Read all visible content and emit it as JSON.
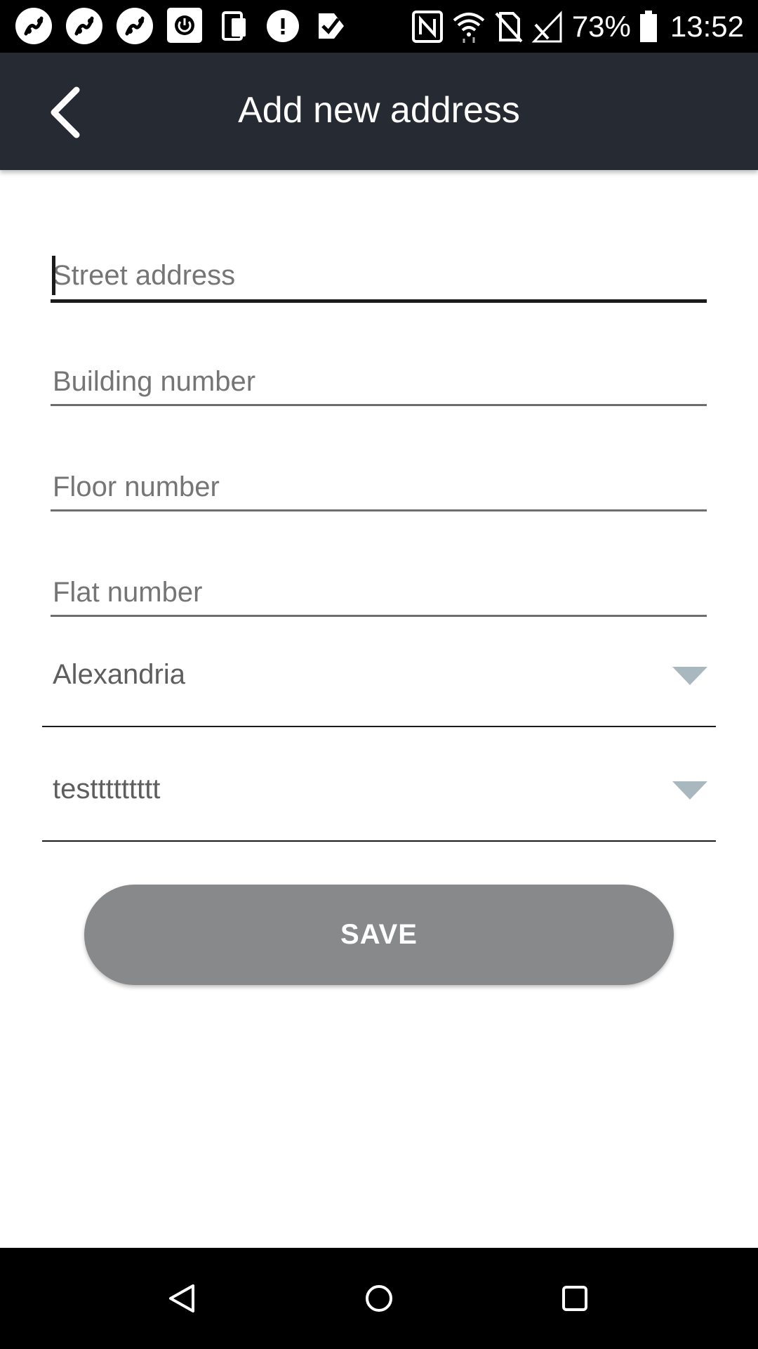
{
  "status_bar": {
    "battery_percent": "73%",
    "time": "13:52",
    "left_icons": [
      "app-notification-icon",
      "app-notification-icon",
      "app-notification-icon",
      "power-icon",
      "device-icon",
      "alert-icon",
      "check-icon"
    ],
    "right_icons": [
      "nfc-icon",
      "wifi-icon",
      "no-sim-icon",
      "signal-icon",
      "battery-icon"
    ]
  },
  "app_bar": {
    "title": "Add new address",
    "background": "#262a32"
  },
  "form": {
    "street_address": {
      "value": "",
      "placeholder": "Street address"
    },
    "building_number": {
      "value": "",
      "placeholder": "Building number"
    },
    "floor_number": {
      "value": "",
      "placeholder": "Floor number"
    },
    "flat_number": {
      "value": "",
      "placeholder": "Flat number"
    },
    "city_select": {
      "selected": "Alexandria"
    },
    "area_select": {
      "selected": "testtttttttt"
    }
  },
  "actions": {
    "save_label": "SAVE",
    "save_color": "#88898b"
  },
  "nav_bar": {
    "buttons": [
      "back-triangle-icon",
      "home-circle-icon",
      "recents-square-icon"
    ]
  }
}
